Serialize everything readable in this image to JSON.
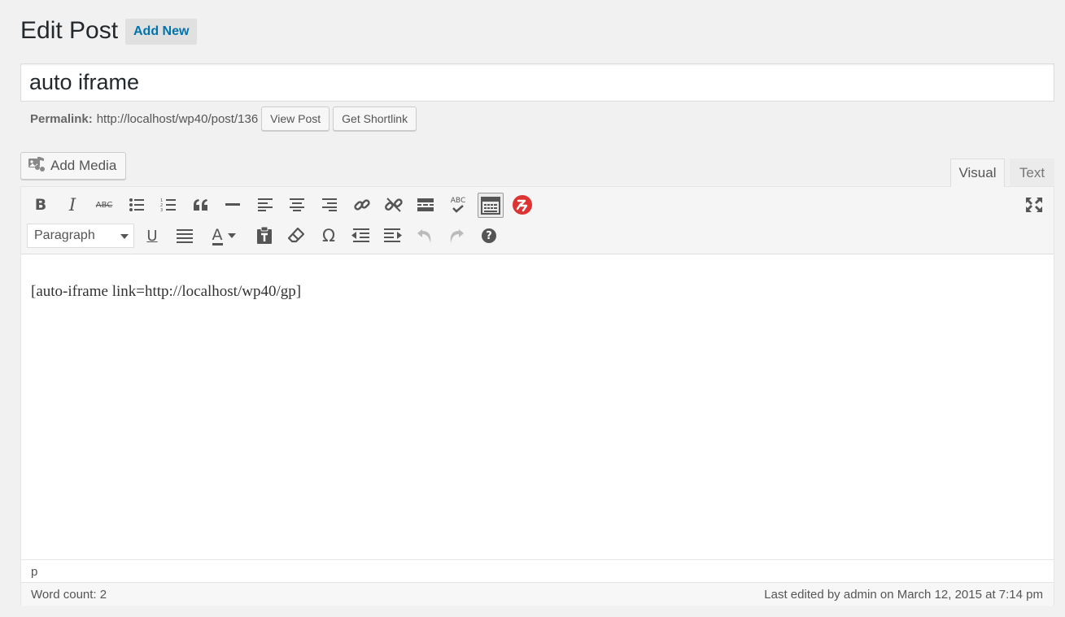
{
  "header": {
    "title": "Edit Post",
    "add_new_label": "Add New"
  },
  "post": {
    "title": "auto iframe"
  },
  "permalink": {
    "label": "Permalink:",
    "url": "http://localhost/wp40/post/136",
    "view_post_label": "View Post",
    "get_shortlink_label": "Get Shortlink"
  },
  "media": {
    "add_media_label": "Add Media"
  },
  "tabs": {
    "visual": "Visual",
    "text": "Text"
  },
  "toolbar": {
    "format_select": {
      "value": "Paragraph"
    },
    "row1_icons": [
      "bold-icon",
      "italic-icon",
      "strikethrough-icon",
      "bulleted-list-icon",
      "numbered-list-icon",
      "blockquote-icon",
      "horizontal-line-icon",
      "align-left-icon",
      "align-center-icon",
      "align-right-icon",
      "insert-link-icon",
      "remove-link-icon",
      "read-more-icon",
      "spellcheck-icon",
      "toolbar-toggle-icon",
      "plugin-icon",
      "fullscreen-icon"
    ],
    "row2_icons": [
      "underline-icon",
      "justify-icon",
      "text-color-icon",
      "paste-as-text-icon",
      "clear-formatting-icon",
      "special-character-icon",
      "outdent-icon",
      "indent-icon",
      "undo-icon",
      "redo-icon",
      "help-icon"
    ],
    "spellcheck_text": "ABC",
    "abc_strike_text": "ABC",
    "bold_glyph": "B",
    "italic_glyph": "I",
    "underline_glyph": "U",
    "textcolor_glyph": "A",
    "omega_glyph": "Ω",
    "help_glyph": "?",
    "accent_plugin_color": "#dd3333"
  },
  "editor": {
    "content": "[auto-iframe link=http://localhost/wp40/gp]"
  },
  "pathbar": {
    "path": "p"
  },
  "status": {
    "word_count": "Word count: 2",
    "last_edited": "Last edited by admin on March 12, 2015 at 7:14 pm"
  }
}
